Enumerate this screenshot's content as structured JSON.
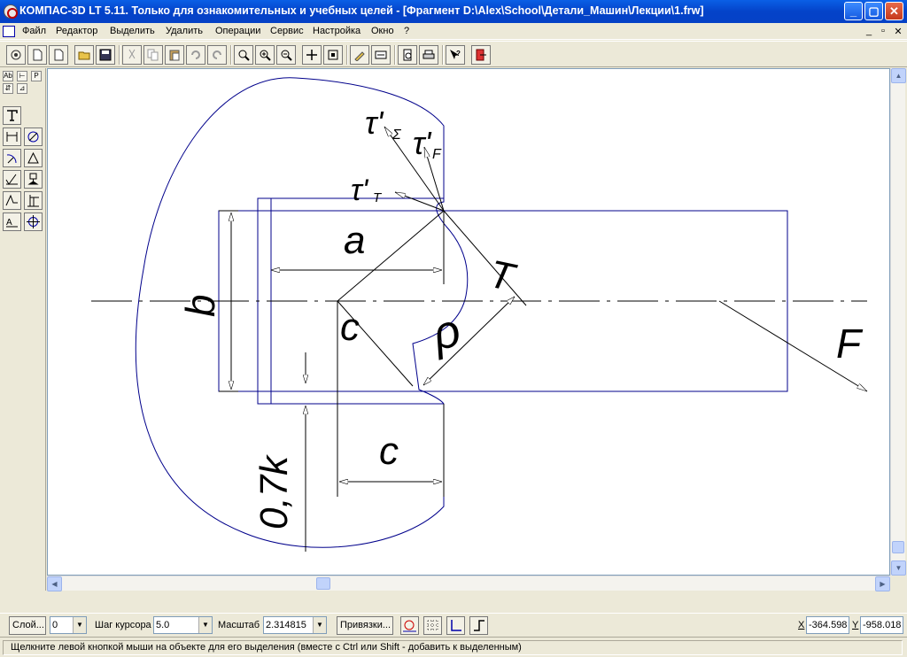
{
  "window": {
    "title": "КОМПАС-3D LT 5.11. Только для ознакомительных и учебных целей - [Фрагмент D:\\Alex\\School\\Детали_Машин\\Лекции\\1.frw]",
    "min": "_",
    "max": "▢",
    "close": "✕"
  },
  "menu": {
    "items": [
      "Файл",
      "Редактор",
      "Выделить",
      "Удалить",
      "Операции",
      "Сервис",
      "Настройка",
      "Окно",
      "?"
    ],
    "mdi": [
      "_",
      "▫",
      "✕"
    ]
  },
  "toolbar": {
    "icons": [
      "pan-view-icon",
      "new-doc-icon",
      "new-sheet-icon",
      "open-folder-icon",
      "save-icon",
      "cut-icon",
      "copy-icon",
      "paste-icon",
      "undo-icon",
      "redo-icon",
      "zoom-icon",
      "zoom-in-icon",
      "zoom-out-icon",
      "move-icon",
      "zoom-fit-icon",
      "edit-icon",
      "layers-icon",
      "print-preview-icon",
      "print-icon",
      "help-icon",
      "exit-icon"
    ]
  },
  "palette": {
    "tabs": [
      "Аb",
      "P"
    ],
    "tools": [
      "text-tool-icon",
      "linear-dim-icon",
      "diameter-dim-icon",
      "radius-dim-icon",
      "angular-dim-icon",
      "roughness-icon",
      "base-icon",
      "leader-icon",
      "table-icon",
      "position-icon",
      "center-mark-icon"
    ]
  },
  "drawing": {
    "labels": {
      "a": "a",
      "b": "b",
      "c1": "c",
      "c2": "c",
      "rho": "ρ",
      "T": "T",
      "F": "F",
      "k": "0,7k",
      "tau_sigma": "τ'",
      "tau_sigma_sub": "Σ",
      "tau_f": "τ'",
      "tau_f_sub": "F",
      "tau_t": "τ'",
      "tau_t_sub": "T"
    },
    "line_color": "#00008b"
  },
  "propbar": {
    "layer_button": "Слой...",
    "layer_value": "0",
    "step_label": "Шаг курсора",
    "step_value": "5.0",
    "scale_label": "Масштаб",
    "scale_value": "2.314815",
    "snap_button": "Привязки...",
    "x_label": "X",
    "x_value": "-364.598",
    "y_label": "Y",
    "y_value": "-958.018"
  },
  "status": {
    "message": "Щелкните левой кнопкой мыши на объекте для его выделения (вместе с Ctrl или Shift - добавить к выделенным)"
  }
}
